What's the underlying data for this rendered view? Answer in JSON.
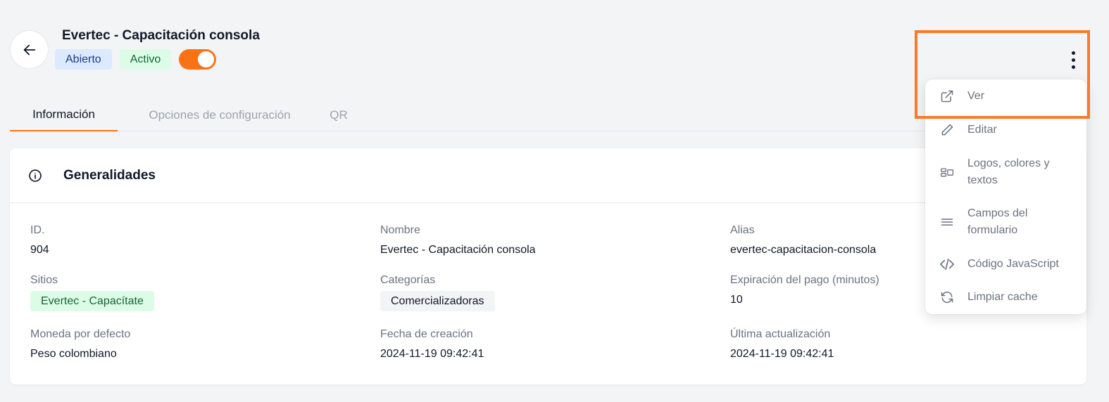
{
  "header": {
    "title": "Evertec - Capacitación consola",
    "badge_status": "Abierto",
    "badge_active": "Activo",
    "toggle_on": true
  },
  "tabs": [
    {
      "label": "Información",
      "active": true
    },
    {
      "label": "Opciones de configuración",
      "active": false
    },
    {
      "label": "QR",
      "active": false
    }
  ],
  "card": {
    "title": "Generalidades",
    "fields": {
      "id": {
        "label": "ID.",
        "value": "904"
      },
      "nombre": {
        "label": "Nombre",
        "value": "Evertec - Capacitación consola"
      },
      "alias": {
        "label": "Alias",
        "value": "evertec-capacitacion-consola"
      },
      "sitios": {
        "label": "Sitios",
        "value": "Evertec - Capacítate"
      },
      "categorias": {
        "label": "Categorías",
        "value": "Comercializadoras"
      },
      "expiracion": {
        "label": "Expiración del pago (minutos)",
        "value": "10"
      },
      "moneda": {
        "label": "Moneda por defecto",
        "value": "Peso colombiano"
      },
      "creacion": {
        "label": "Fecha de creación",
        "value": "2024-11-19 09:42:41"
      },
      "actualizacion": {
        "label": "Última actualización",
        "value": "2024-11-19 09:42:41"
      }
    }
  },
  "menu": {
    "items": [
      {
        "label": "Ver",
        "icon": "external-link-icon"
      },
      {
        "label": "Editar",
        "icon": "pencil-icon"
      },
      {
        "label": "Logos, colores y textos",
        "icon": "layout-icon"
      },
      {
        "label": "Campos del formulario",
        "icon": "menu-lines-icon"
      },
      {
        "label": "Código JavaScript",
        "icon": "code-icon"
      },
      {
        "label": "Limpiar cache",
        "icon": "refresh-icon"
      }
    ]
  },
  "colors": {
    "accent": "#f97316",
    "highlight": "#f97a2a",
    "badge_blue_bg": "#dbeafe",
    "badge_green_bg": "#dcfce7"
  }
}
